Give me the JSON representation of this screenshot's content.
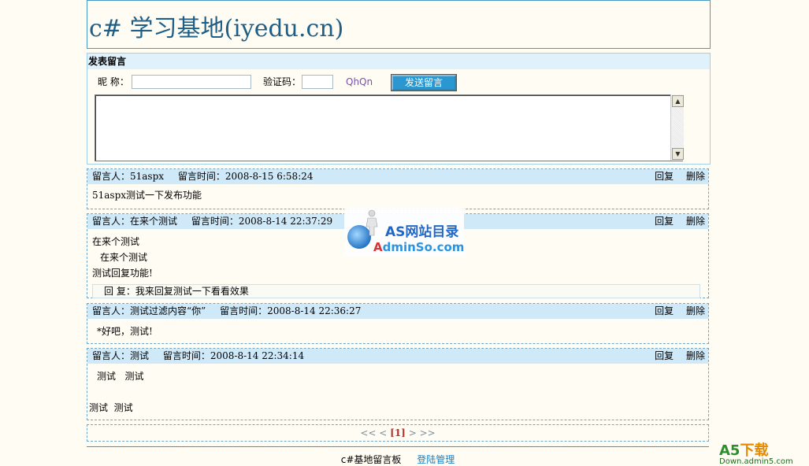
{
  "site_title": "c# 学习基地(iyedu.cn)",
  "post_form": {
    "header": "发表留言",
    "nickname_label": "昵 称：",
    "nickname_value": "",
    "captcha_label": "验证码：",
    "captcha_value": "",
    "captcha_code": "QhQn",
    "submit_label": "发送留言",
    "content_value": ""
  },
  "messages": [
    {
      "author_label": "留言人：51aspx",
      "time_label": "留言时间：2008-8-15 6:58:24",
      "reply_action": "回复",
      "delete_action": "删除",
      "lines": [
        "51aspx测试一下发布功能"
      ]
    },
    {
      "author_label": "留言人：在来个测试",
      "time_label": "留言时间：2008-8-14 22:37:29",
      "reply_action": "回复",
      "delete_action": "删除",
      "lines": [
        "在来个测试",
        "在来个测试",
        "测试回复功能!"
      ],
      "admin_reply": "回 复：我来回复测试一下看看效果"
    },
    {
      "author_label": "留言人：测试过滤内容“你”",
      "time_label": "留言时间：2008-8-14 22:36:27",
      "reply_action": "回复",
      "delete_action": "删除",
      "lines": [
        "*好吧，测试!"
      ]
    },
    {
      "author_label": "留言人：测试",
      "time_label": "留言时间：2008-8-14 22:34:14",
      "reply_action": "回复",
      "delete_action": "删除",
      "lines": [
        "测试   测试",
        "测试  测试"
      ]
    }
  ],
  "pager": {
    "prev_first": "<<",
    "prev": "<",
    "current": "[1]",
    "next": ">",
    "next_last": ">>"
  },
  "footer": {
    "board_name": "c#基地留言板",
    "login_link": "登陆管理"
  },
  "watermark": {
    "line1": "AS网站目录",
    "line2_part1": "A",
    "line2_part2": "dminSo.com"
  },
  "corner_logo": {
    "text_a": "A5",
    "text_b": "下载",
    "domain": "Down.admin5.com"
  }
}
